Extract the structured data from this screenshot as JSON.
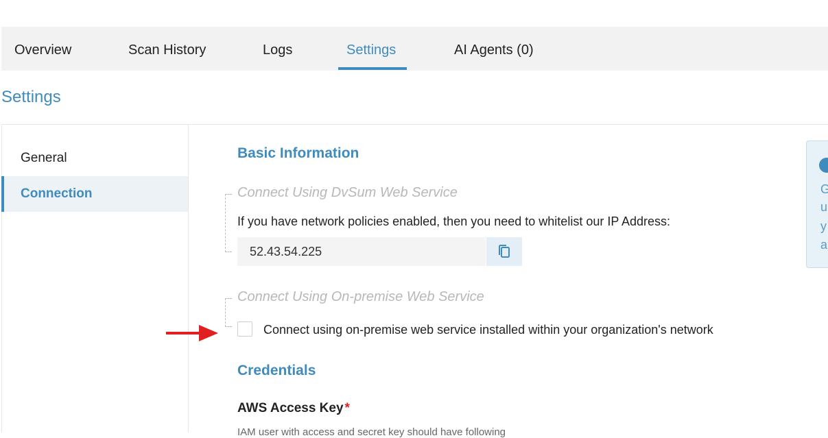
{
  "tabs": [
    {
      "label": "Overview",
      "active": false
    },
    {
      "label": "Scan History",
      "active": false
    },
    {
      "label": "Logs",
      "active": false
    },
    {
      "label": "Settings",
      "active": true
    },
    {
      "label": "AI Agents (0)",
      "active": false
    }
  ],
  "page": {
    "title": "Settings"
  },
  "sidebar": {
    "items": [
      {
        "label": "General",
        "active": false
      },
      {
        "label": "Connection",
        "active": true
      }
    ]
  },
  "basic_info": {
    "heading": "Basic Information",
    "dvsum_group": {
      "label": "Connect Using DvSum Web Service",
      "description": "If you have network policies enabled, then you need to whitelist our IP Address:",
      "ip_address": "52.43.54.225",
      "copy_icon": "copy-icon"
    },
    "onprem_group": {
      "label": "Connect Using On-premise Web Service",
      "checkbox_label": "Connect using on-premise web service installed within your organization's network",
      "checked": false
    }
  },
  "credentials": {
    "heading": "Credentials",
    "aws_access_key": {
      "label": "AWS Access Key",
      "required_marker": "*",
      "help": "IAM user with access and secret key should have following"
    }
  },
  "info_panel": {
    "icon": "info-icon",
    "lines": [
      "G",
      "u",
      "y",
      "ar"
    ]
  },
  "annotation": {
    "icon": "red-arrow",
    "color": "#e02020"
  },
  "colors": {
    "accent": "#3f8bbd",
    "tab_bar": "#f2f2f2",
    "required": "#e02020"
  }
}
